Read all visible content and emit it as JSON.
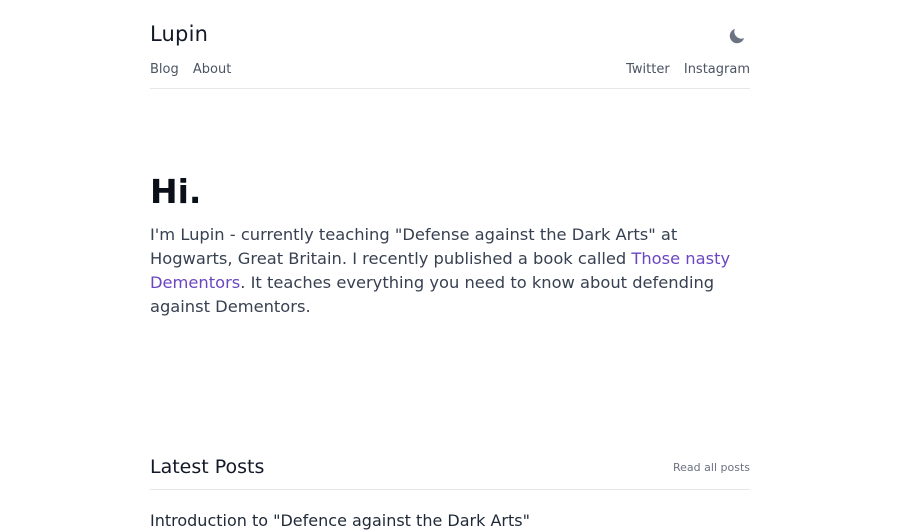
{
  "header": {
    "site_title": "Lupin",
    "theme_toggle_icon": "moon-icon",
    "nav_left": [
      {
        "label": "Blog"
      },
      {
        "label": "About"
      }
    ],
    "nav_right": [
      {
        "label": "Twitter"
      },
      {
        "label": "Instagram"
      }
    ]
  },
  "hero": {
    "heading": "Hi.",
    "text_before_link": "I'm Lupin - currently teaching \"Defense against the Dark Arts\" at Hogwarts, Great Britain. I recently published a book called ",
    "link_text": "Those nasty Dementors",
    "text_after_link": ". It teaches everything you need to know about defending against Dementors."
  },
  "latest_posts": {
    "title": "Latest Posts",
    "read_all_label": "Read all posts",
    "posts": [
      {
        "title": "Introduction to \"Defence against the Dark Arts\""
      }
    ]
  },
  "colors": {
    "link": "#6b46c1",
    "icon": "#6b7280",
    "divider": "#e5e7eb"
  }
}
